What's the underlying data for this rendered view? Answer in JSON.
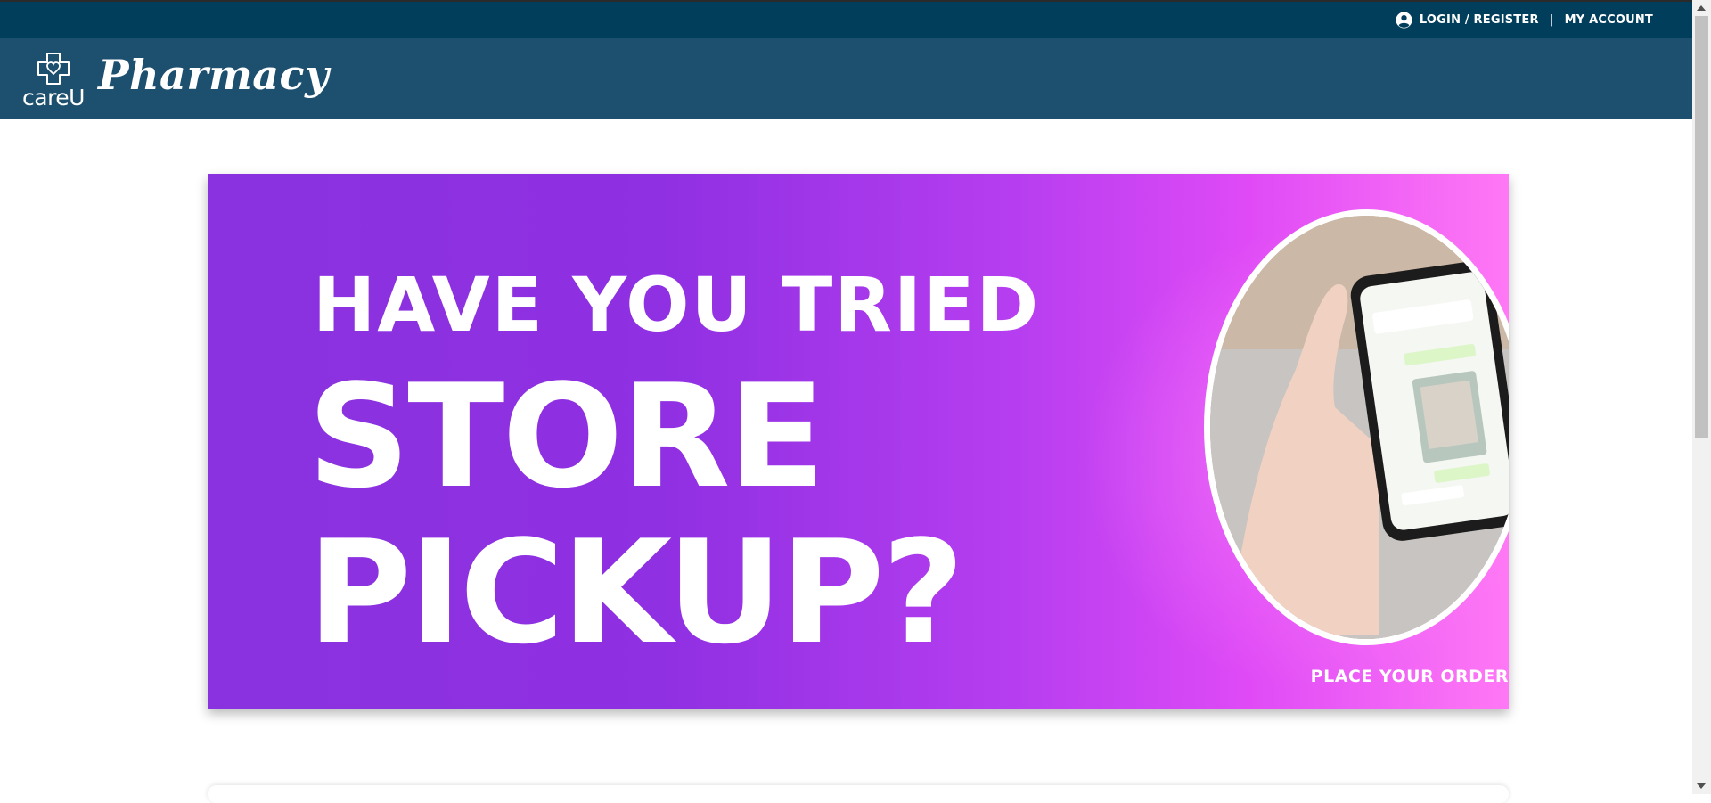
{
  "topbar": {
    "login_label": "LOGIN / REGISTER",
    "separator": "|",
    "account_label": "MY ACCOUNT",
    "icon": "user-circle-icon"
  },
  "header": {
    "logo_text": "careU",
    "brand": "Pharmacy",
    "logo_icon": "cross-heart-icon"
  },
  "banner": {
    "line1": "HAVE YOU TRIED",
    "line2": "STORE",
    "line3": "PICKUP?",
    "cta": "PLACE YOUR ORDER"
  },
  "colors": {
    "topbar_bg": "#003e5c",
    "header_bg": "#1d4f6e",
    "banner_purple": "#8a32df",
    "banner_pink": "#ff78f5"
  }
}
